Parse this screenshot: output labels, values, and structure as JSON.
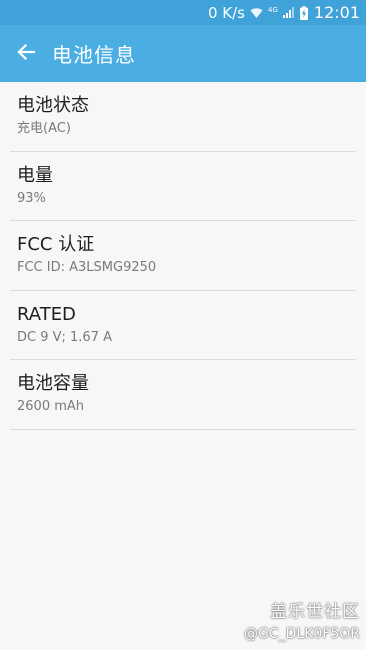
{
  "status_bar": {
    "speed": "0 K/s",
    "network": "4G",
    "time": "12:01",
    "icons": [
      "wifi-icon",
      "signal-icon",
      "battery-charging-icon"
    ]
  },
  "app_bar": {
    "title": "电池信息",
    "back_icon": "arrow-left-icon",
    "color": "#4aaee3"
  },
  "items": [
    {
      "title": "电池状态",
      "subtitle": "充电(AC)"
    },
    {
      "title": "电量",
      "subtitle": "93%"
    },
    {
      "title": "FCC 认证",
      "subtitle": "FCC ID: A3LSMG9250"
    },
    {
      "title": "RATED",
      "subtitle": "DC 9 V; 1.67 A"
    },
    {
      "title": "电池容量",
      "subtitle": "2600 mAh"
    }
  ],
  "watermark": {
    "logo": "盖乐世社区",
    "user": "@GC_DLK0F5OR"
  }
}
